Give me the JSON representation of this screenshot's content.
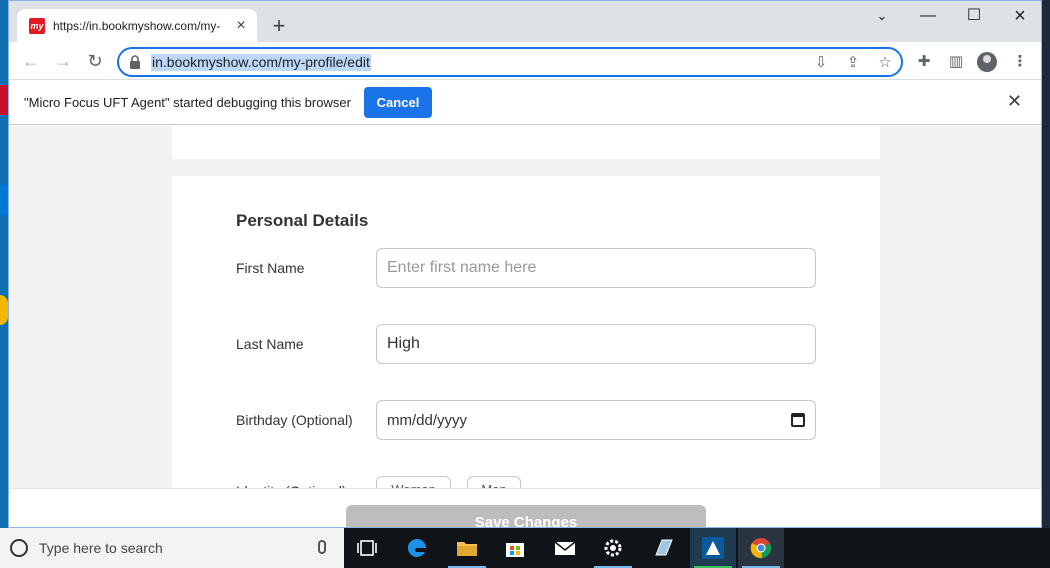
{
  "browser": {
    "tab_title": "https://in.bookmyshow.com/my-",
    "favicon_text": "my",
    "url": "in.bookmyshow.com/my-profile/edit"
  },
  "infobar": {
    "message": "\"Micro Focus UFT Agent\" started debugging this browser",
    "cancel_label": "Cancel"
  },
  "page": {
    "section_title": "Personal Details",
    "first_name": {
      "label": "First Name",
      "value": "",
      "placeholder": "Enter first name here"
    },
    "last_name": {
      "label": "Last Name",
      "value": "High"
    },
    "birthday": {
      "label": "Birthday (Optional)",
      "value": "mm/dd/yyyy"
    },
    "identity": {
      "label": "Identity (Optional)",
      "options": [
        "Woman",
        "Man"
      ]
    },
    "save_label": "Save Changes"
  },
  "taskbar": {
    "search_placeholder": "Type here to search"
  },
  "colors": {
    "accent": "#1a73e8",
    "brand": "#e21a23",
    "save_disabled": "#bdbdbd"
  }
}
